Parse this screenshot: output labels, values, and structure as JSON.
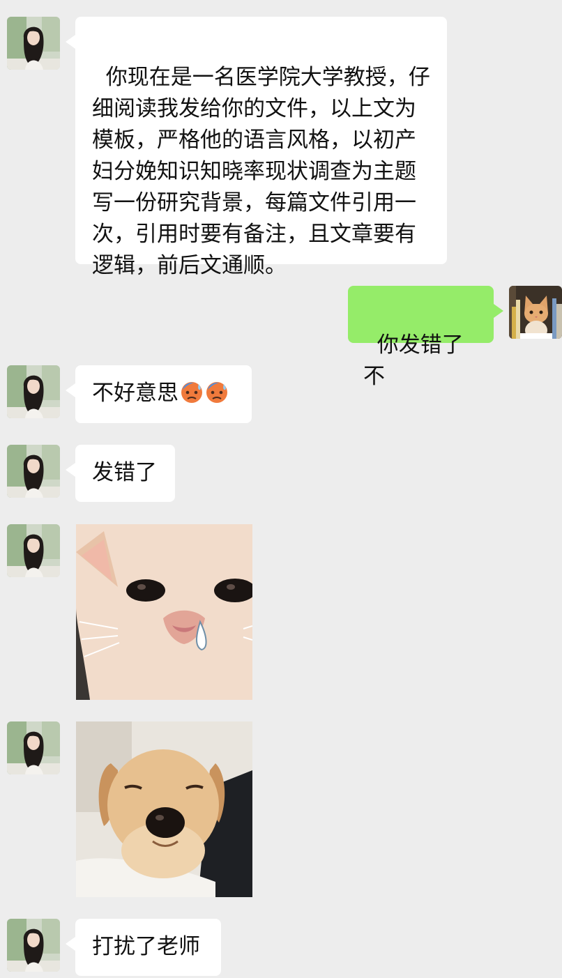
{
  "chat": {
    "messages": [
      {
        "sender": "other",
        "type": "text",
        "avatar": "girl-avatar",
        "text": "你现在是一名医学院大学教授，仔细阅读我发给你的文件，以上文为模板，严格他的语言风格，以初产妇分娩知识知晓率现状调查为主题写一份研究背景，每篇文件引用一次，引用时要有备注，且文章要有逻辑，前后文通顺。"
      },
      {
        "sender": "self",
        "type": "text",
        "avatar": "cat-avatar",
        "text": "你发错了不"
      },
      {
        "sender": "other",
        "type": "text",
        "avatar": "girl-avatar",
        "text": "不好意思",
        "emojis": [
          "cold-sweat-emoji",
          "cold-sweat-emoji"
        ]
      },
      {
        "sender": "other",
        "type": "text",
        "avatar": "girl-avatar",
        "text": "发错了"
      },
      {
        "sender": "other",
        "type": "sticker",
        "avatar": "girl-avatar",
        "sticker": "crying-kitten-sticker"
      },
      {
        "sender": "other",
        "type": "sticker",
        "avatar": "girl-avatar",
        "sticker": "sleepy-puppy-sticker"
      },
      {
        "sender": "other",
        "type": "text",
        "avatar": "girl-avatar",
        "text": "打扰了老师"
      }
    ]
  },
  "colors": {
    "background": "#ededed",
    "incoming_bubble": "#ffffff",
    "outgoing_bubble": "#95ec69",
    "text": "#111111"
  }
}
